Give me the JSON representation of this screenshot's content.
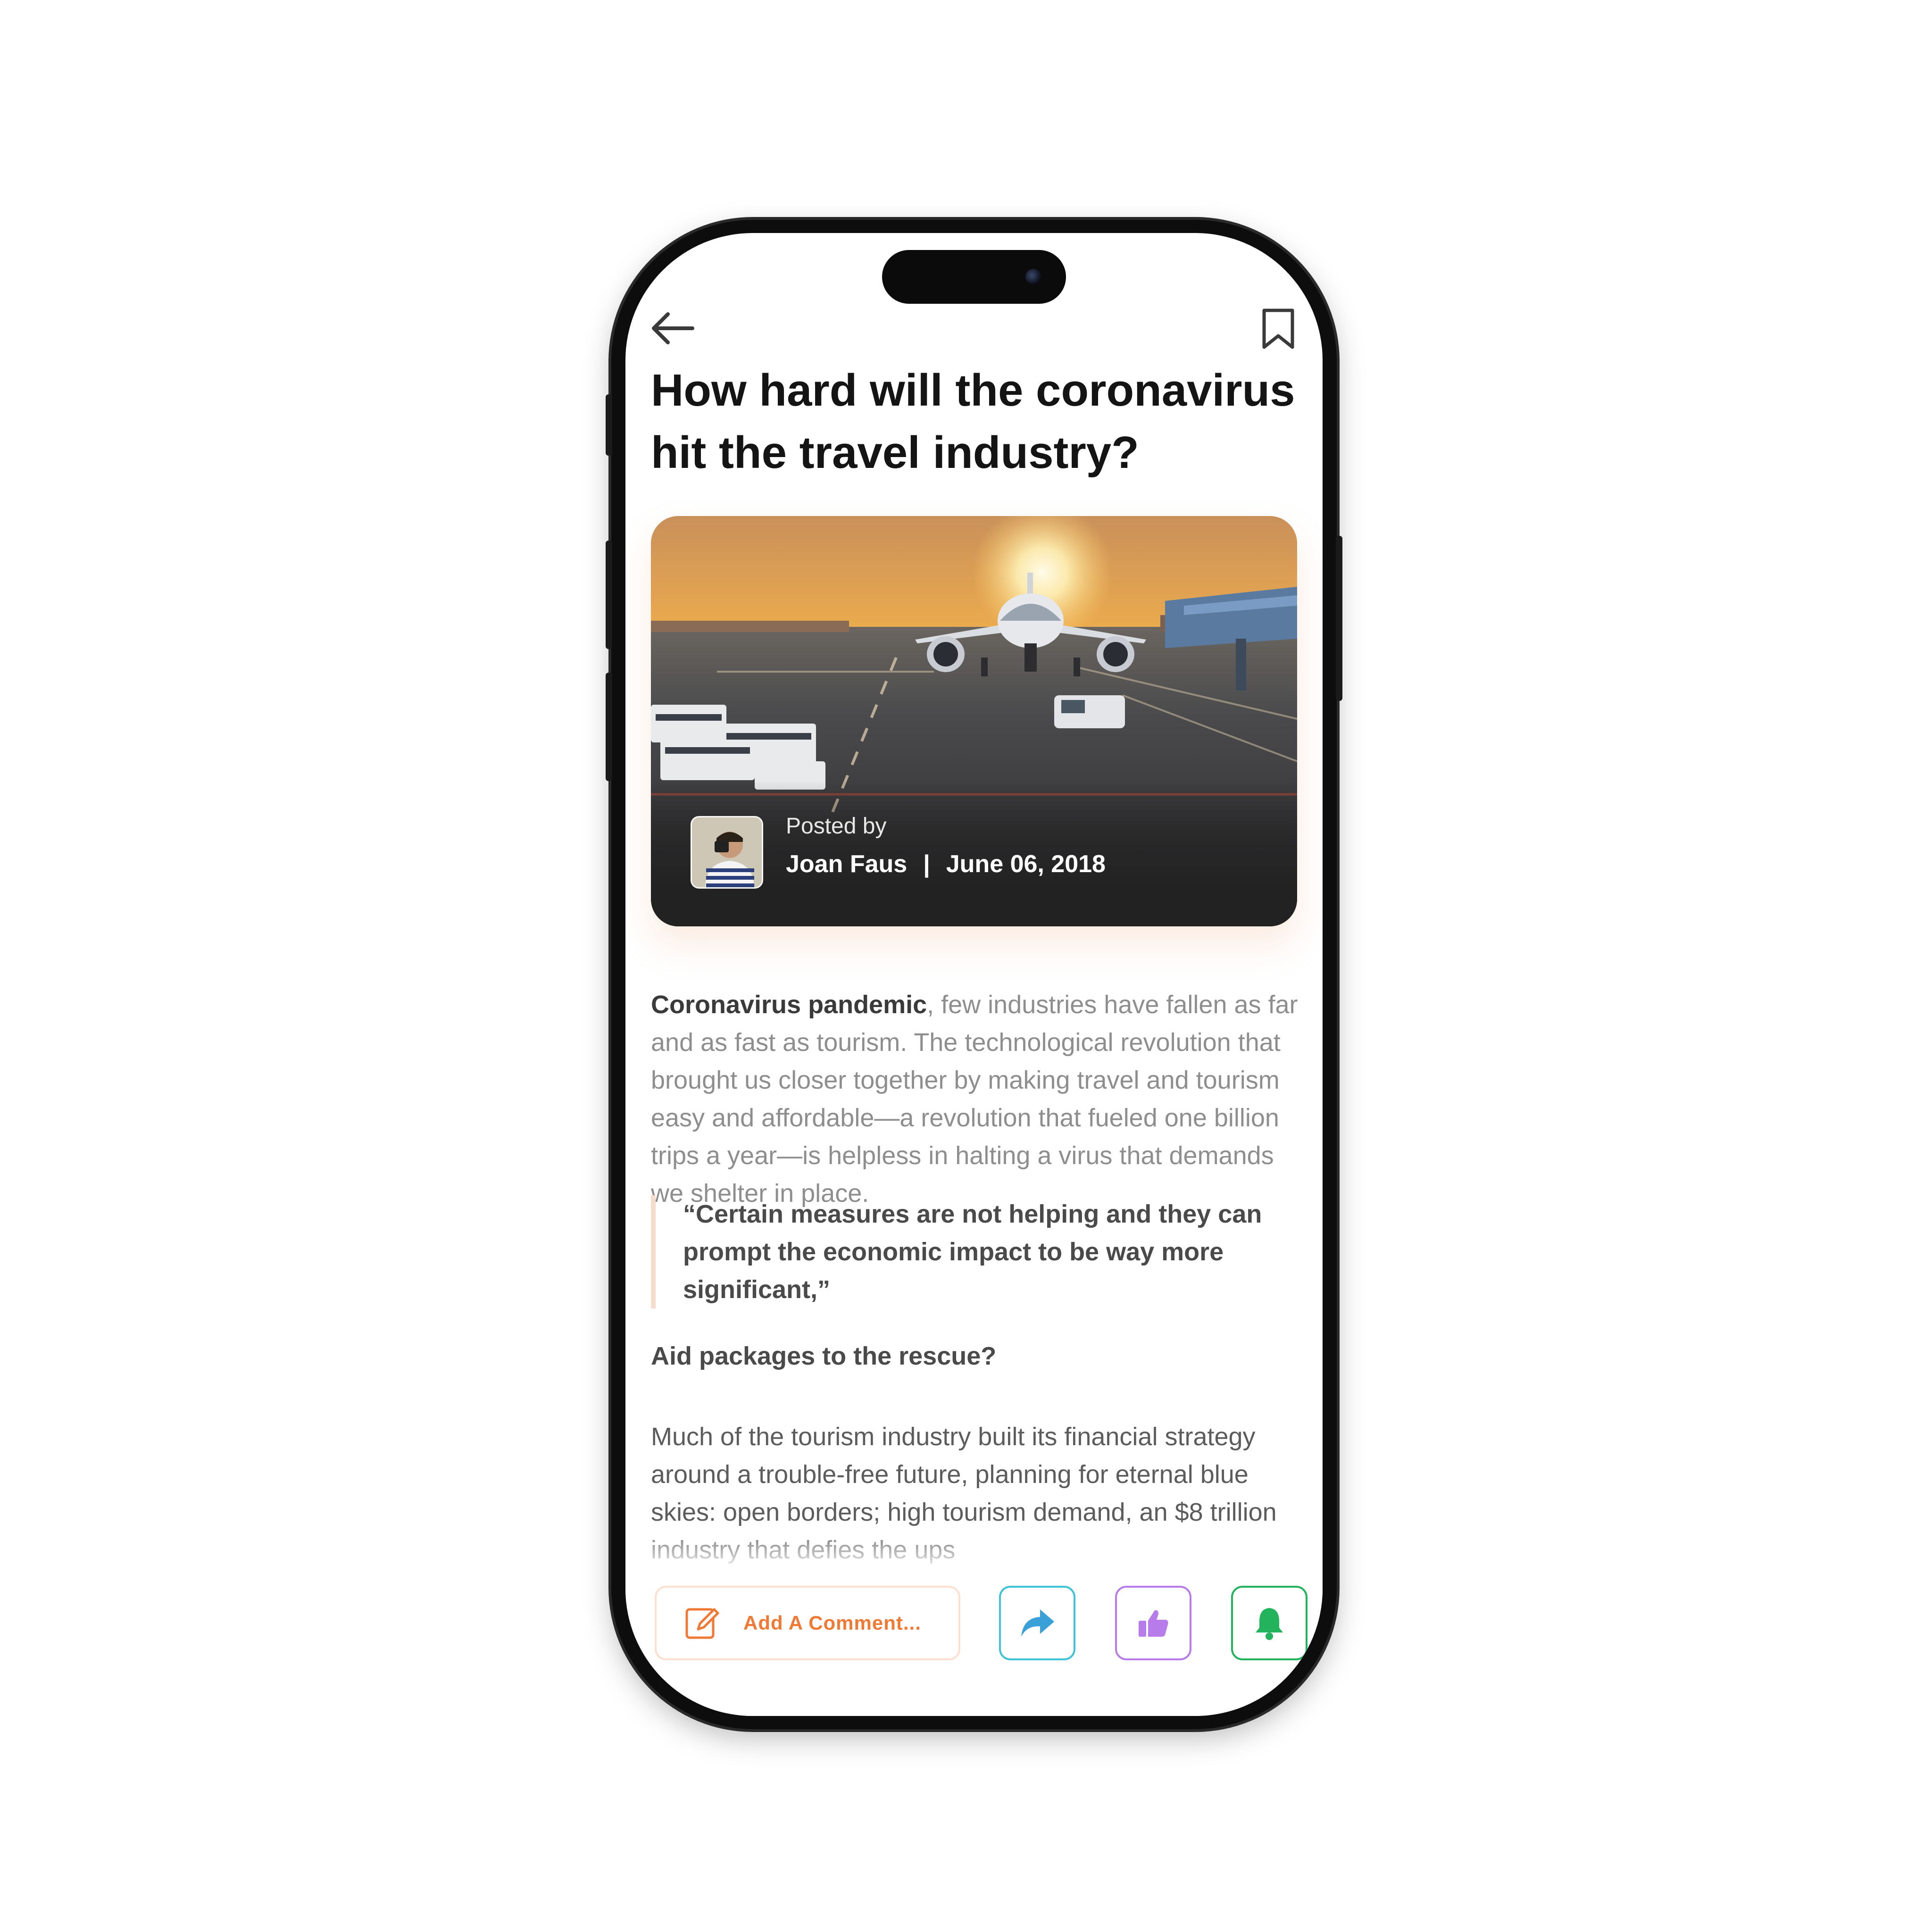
{
  "article": {
    "title": "How hard will the coronavirus hit the travel industry?",
    "posted_label": "Posted by",
    "author": "Joan Faus",
    "separator": "|",
    "date": "June 06, 2018",
    "intro_bold": "Coronavirus pandemic",
    "intro_rest": ", few industries have fallen as far and as fast as tourism. The technological revolution that brought us closer together by making travel and tourism easy and affordable—a revolution that fueled one billion trips a year—is helpless in halting a virus that demands we shelter in place.",
    "quote": "“Certain measures are not helping and they can prompt the economic impact to be way more significant,”",
    "subhead": "Aid packages to the rescue?",
    "paragraph2": "Much of the tourism industry built its financial strategy around a trouble-free future, planning for eternal blue skies: open borders; high tourism demand, an $8 trillion industry that defies the ups"
  },
  "actions": {
    "comment_placeholder": "Add A Comment..."
  },
  "icons": {
    "back": "arrow-left-icon",
    "bookmark": "bookmark-icon",
    "comment": "edit-icon",
    "share": "share-arrow-icon",
    "like": "thumbs-up-icon",
    "notify": "bell-icon"
  },
  "colors": {
    "comment_accent": "#f07a35",
    "comment_border": "#fde0cf",
    "share": "#3fc3d6",
    "like": "#b77bea",
    "notify": "#22b35c",
    "quote_bar": "#f6dccd"
  }
}
